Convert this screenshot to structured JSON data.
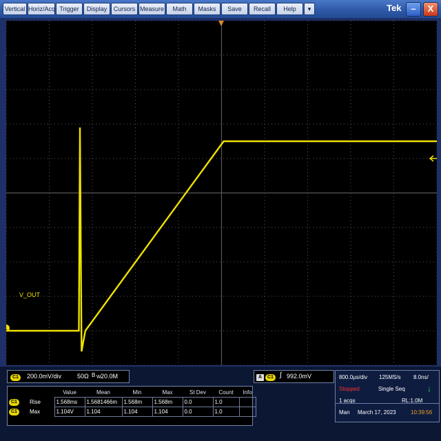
{
  "menu": [
    "Vertical",
    "Horiz/Acq",
    "Trigger",
    "Display",
    "Cursors",
    "Measure",
    "Math",
    "Masks",
    "Save",
    "Recall",
    "Help"
  ],
  "menu_dropdown_icon": "triangle-down-icon",
  "brand": "Tek",
  "window_buttons": {
    "minimize_icon": "minimize-icon",
    "close_icon": "close-icon",
    "close_glyph": "X"
  },
  "waveform": {
    "label": "V_OUT",
    "channel_marker": "1",
    "color": "#f0e100",
    "trace": {
      "baseline_v": -0.8,
      "glitch_up_v": 0.38,
      "glitch_down_v": -0.92,
      "ramp_start_ms": -2.65,
      "ramp_end_ms": 0.04,
      "flat_top_v": 0.3
    },
    "trigger_level_icon": "trigger-level-arrow-icon"
  },
  "scope": {
    "h_divs": 10,
    "v_divs": 10,
    "grid_color": "#5a5a5a"
  },
  "channel": {
    "badge": "C1",
    "scale": "200.0mV/div",
    "impedance": "50Ω",
    "bandwidth": "20.0M",
    "bandwidth_prefix": "B"
  },
  "trigger": {
    "source_badge": "A",
    "channel_badge": "C1",
    "slope_icon": "rising-edge-icon",
    "level": "992.0mV"
  },
  "measurements": {
    "headers": [
      "",
      "",
      "Value",
      "Mean",
      "Min",
      "Max",
      "St Dev",
      "Count",
      "Info"
    ],
    "rows": [
      {
        "badge": "C1",
        "name": "Rise",
        "value": "1.568ms",
        "mean": "1.5681466m",
        "min": "1.568m",
        "max": "1.568m",
        "stdev": "0.0",
        "count": "1.0",
        "info": ""
      },
      {
        "badge": "C1",
        "name": "Max",
        "value": "1.104V",
        "mean": "1.104",
        "min": "1.104",
        "max": "1.104",
        "stdev": "0.0",
        "count": "1.0",
        "info": ""
      }
    ]
  },
  "acquisition": {
    "timebase": "800.0µs/div",
    "sample_rate": "125MS/s",
    "resolution": "8.0ns/",
    "state": "Stopped",
    "state_color": "#ff3030",
    "mode": "Single Seq",
    "mode_icon": "green-arrow-down-icon",
    "acqs": "1 acqs",
    "record_length": "RL:1.0M",
    "trigger_mode": "Man",
    "date": "March 17, 2023",
    "time": "10:39:56",
    "time_color": "#f0a020"
  }
}
